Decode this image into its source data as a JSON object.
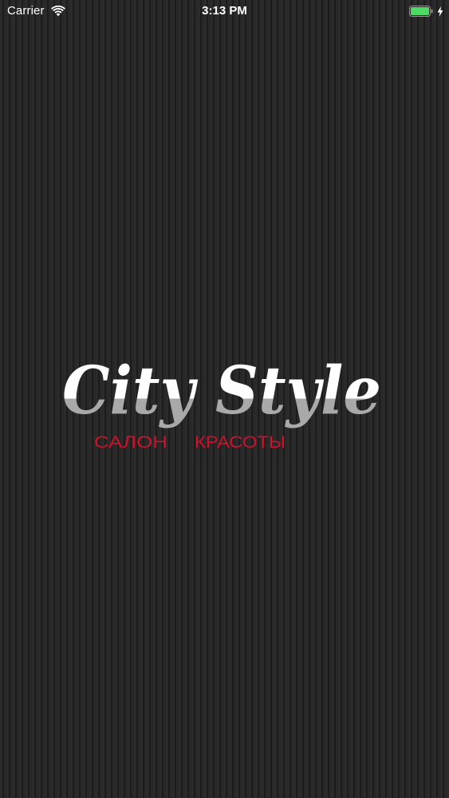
{
  "status_bar": {
    "carrier": "Carrier",
    "time": "3:13 PM",
    "wifi_icon": "wifi-icon",
    "battery_icon": "battery-icon",
    "charging_icon": "charging-bolt-icon",
    "battery_color": "#4cd964"
  },
  "splash": {
    "logo_title": "City Style",
    "logo_subtitle_left": "САЛОН",
    "logo_subtitle_right": "КРАСОТЫ",
    "title_color_top": "#ffffff",
    "title_color_bottom": "#a9a9a9",
    "subtitle_color": "#d0112b",
    "background_color": "#262626"
  }
}
